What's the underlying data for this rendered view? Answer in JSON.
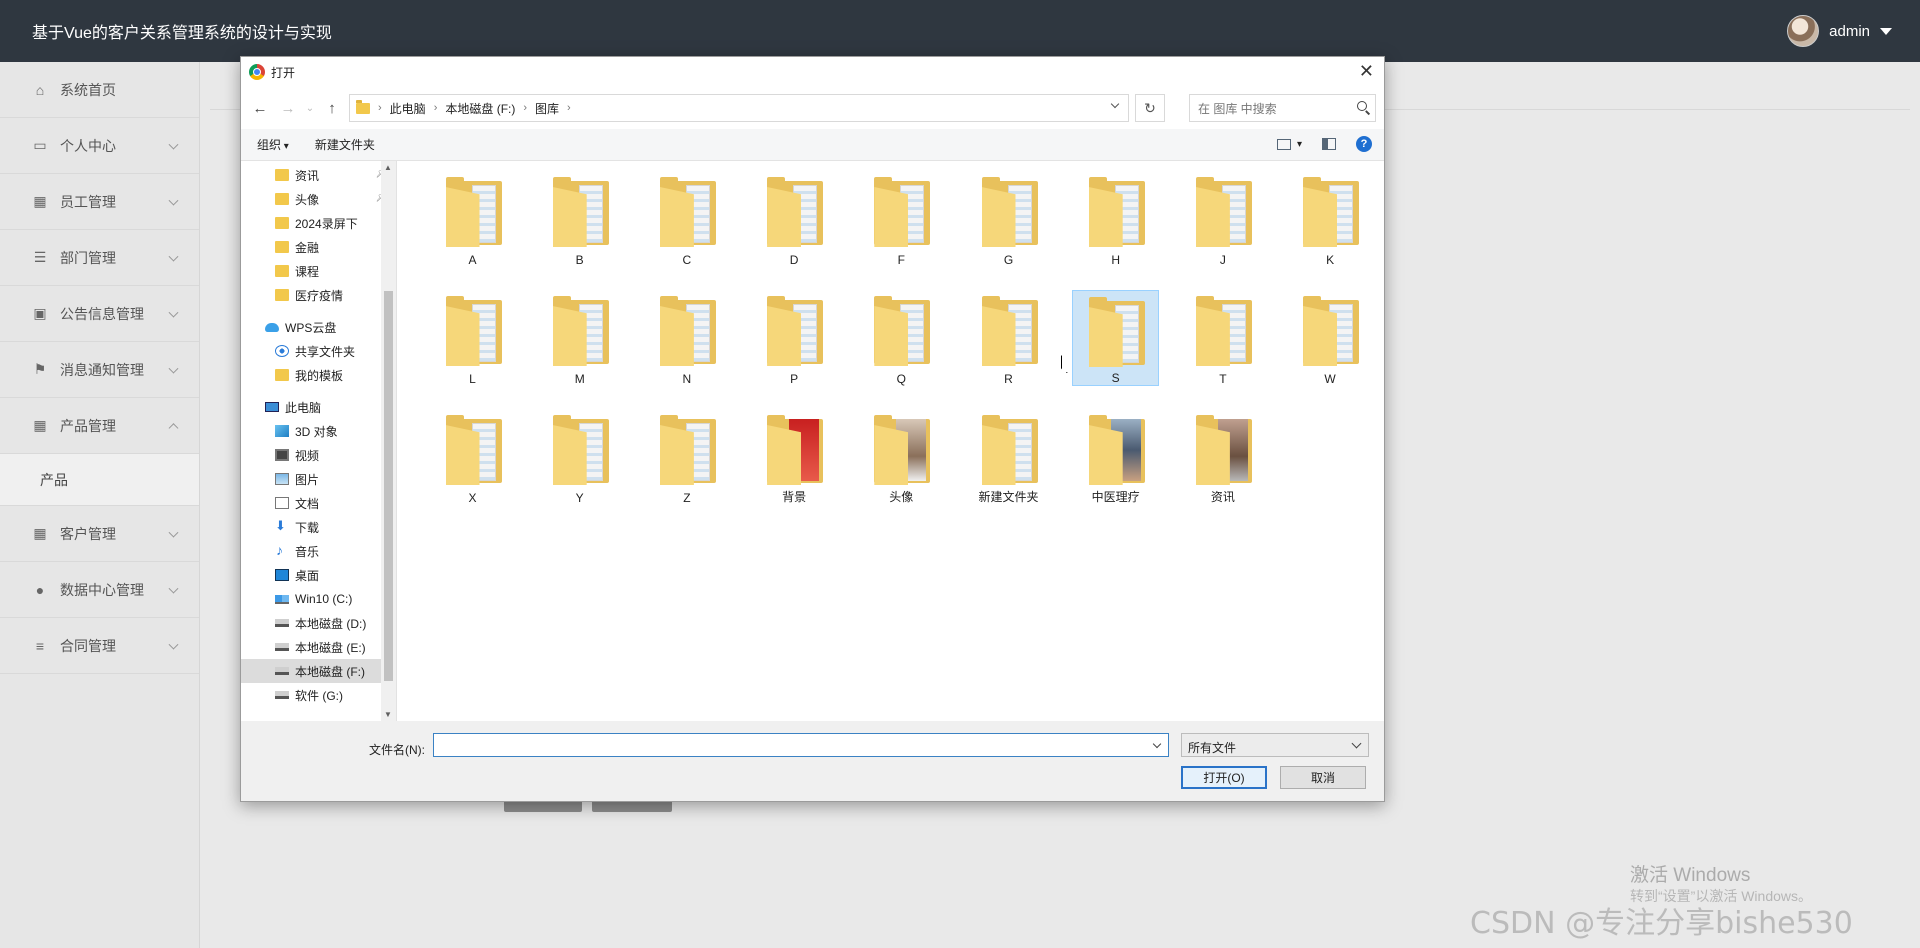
{
  "app": {
    "title": "基于Vue的客户关系管理系统的设计与实现",
    "user": "admin"
  },
  "sidebar": {
    "items": [
      {
        "label": "系统首页",
        "icon": "home-icon"
      },
      {
        "label": "个人中心",
        "icon": "calendar-icon"
      },
      {
        "label": "员工管理",
        "icon": "grid-icon"
      },
      {
        "label": "部门管理",
        "icon": "list-icon"
      },
      {
        "label": "公告信息管理",
        "icon": "briefcase-icon"
      },
      {
        "label": "消息通知管理",
        "icon": "flag-icon"
      },
      {
        "label": "产品管理",
        "icon": "grid-icon"
      },
      {
        "label": "客户管理",
        "icon": "apps-icon"
      },
      {
        "label": "数据中心管理",
        "icon": "user-icon"
      },
      {
        "label": "合同管理",
        "icon": "sliders-icon"
      }
    ],
    "subitem": "产品"
  },
  "dialog": {
    "title": "打开",
    "breadcrumb": [
      "此电脑",
      "本地磁盘 (F:)",
      "图库"
    ],
    "search_placeholder": "在 图库 中搜索",
    "toolbar": {
      "organize": "组织",
      "new_folder": "新建文件夹"
    },
    "nav": {
      "quick": [
        "资讯",
        "头像",
        "2024录屏下",
        "金融",
        "课程",
        "医疗疫情"
      ],
      "cloud": [
        "WPS云盘",
        "共享文件夹",
        "我的模板"
      ],
      "pc": "此电脑",
      "pc_items": [
        "3D 对象",
        "视频",
        "图片",
        "文档",
        "下载",
        "音乐",
        "桌面",
        "Win10 (C:)",
        "本地磁盘 (D:)",
        "本地磁盘 (E:)",
        "本地磁盘 (F:)",
        "软件 (G:)"
      ]
    },
    "files": [
      "A",
      "B",
      "C",
      "D",
      "F",
      "G",
      "H",
      "J",
      "K",
      "L",
      "M",
      "N",
      "P",
      "Q",
      "R",
      "S",
      "T",
      "W",
      "X",
      "Y",
      "Z",
      "背景",
      "头像",
      "新建文件夹",
      "中医理疗",
      "资讯"
    ],
    "selected_file": "S",
    "filename_label": "文件名(N):",
    "filename_value": "",
    "filetype": "所有文件",
    "open_label": "打开(O)",
    "cancel_label": "取消"
  },
  "watermarks": {
    "activate": "激活 Windows",
    "activate_sub": "转到“设置”以激活 Windows。",
    "csdn": "CSDN @专注分享bishe530"
  }
}
